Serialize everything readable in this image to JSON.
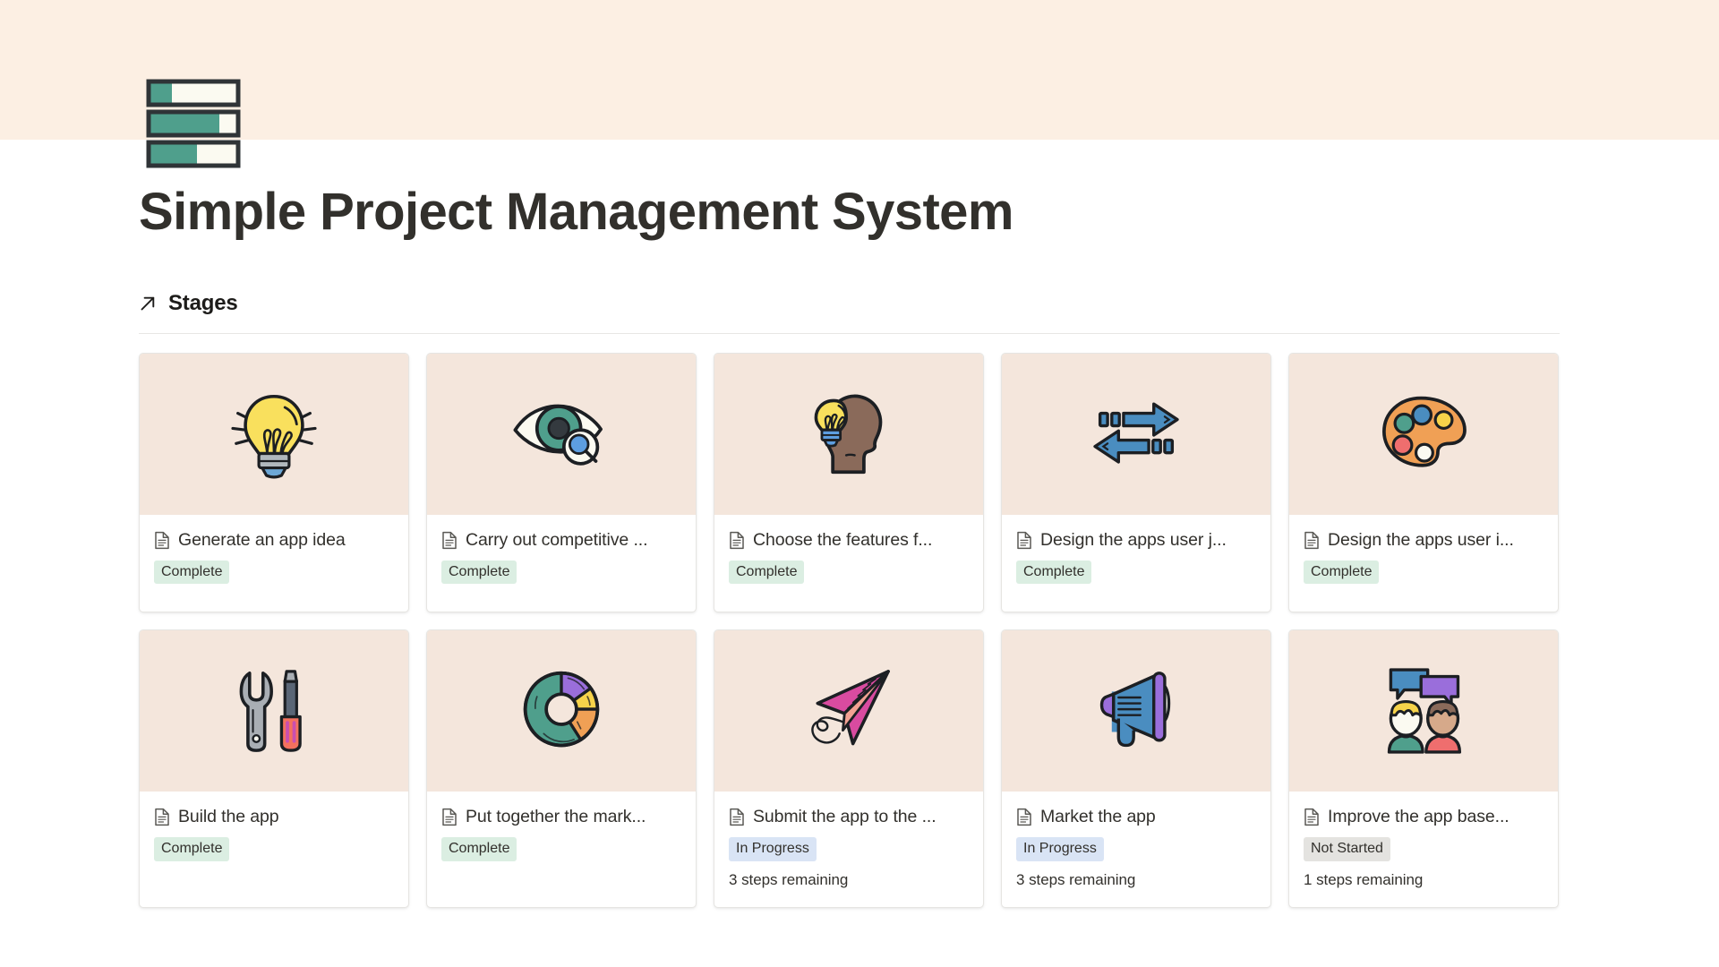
{
  "banner": {
    "background_color": "#fcefe3"
  },
  "page_icon": {
    "name": "progress-bars-icon",
    "bar_fill_color": "#4f9f8c",
    "bar_track_color": "#fbfaf1",
    "bar_outline_color": "#2f3437",
    "bars": [
      {
        "fill_percent": 26
      },
      {
        "fill_percent": 79
      },
      {
        "fill_percent": 54
      }
    ]
  },
  "header": {
    "title": "Simple Project Management System"
  },
  "section": {
    "arrow_icon": "arrow-up-right-icon",
    "title": "Stages"
  },
  "status_colors": {
    "complete": "#dbeee2",
    "in_progress": "#d9e4f5",
    "not_started": "#e4e3e0"
  },
  "cards": [
    {
      "icon": "lightbulb-icon",
      "doc_icon": "document-icon",
      "title": "Generate an app idea",
      "status": "Complete",
      "status_kind": "complete",
      "steps": null
    },
    {
      "icon": "eye-magnifier-icon",
      "doc_icon": "document-icon",
      "title": "Carry out competitive ...",
      "status": "Complete",
      "status_kind": "complete",
      "steps": null
    },
    {
      "icon": "head-lightbulb-icon",
      "doc_icon": "document-icon",
      "title": "Choose the features f...",
      "status": "Complete",
      "status_kind": "complete",
      "steps": null
    },
    {
      "icon": "two-way-arrows-icon",
      "doc_icon": "document-icon",
      "title": "Design the apps user j...",
      "status": "Complete",
      "status_kind": "complete",
      "steps": null
    },
    {
      "icon": "paint-palette-icon",
      "doc_icon": "document-icon",
      "title": "Design the apps user i...",
      "status": "Complete",
      "status_kind": "complete",
      "steps": null
    },
    {
      "icon": "wrench-screwdriver-icon",
      "doc_icon": "document-icon",
      "title": "Build the app",
      "status": "Complete",
      "status_kind": "complete",
      "steps": null
    },
    {
      "icon": "donut-chart-icon",
      "doc_icon": "document-icon",
      "title": "Put together the mark...",
      "status": "Complete",
      "status_kind": "complete",
      "steps": null
    },
    {
      "icon": "paper-plane-icon",
      "doc_icon": "document-icon",
      "title": "Submit the app to the ...",
      "status": "In Progress",
      "status_kind": "inprogress",
      "steps": "3 steps remaining"
    },
    {
      "icon": "megaphone-icon",
      "doc_icon": "document-icon",
      "title": "Market the app",
      "status": "In Progress",
      "status_kind": "inprogress",
      "steps": "3 steps remaining"
    },
    {
      "icon": "people-speech-bubbles-icon",
      "doc_icon": "document-icon",
      "title": "Improve the app base...",
      "status": "Not Started",
      "status_kind": "notstarted",
      "steps": "1 steps remaining"
    }
  ]
}
